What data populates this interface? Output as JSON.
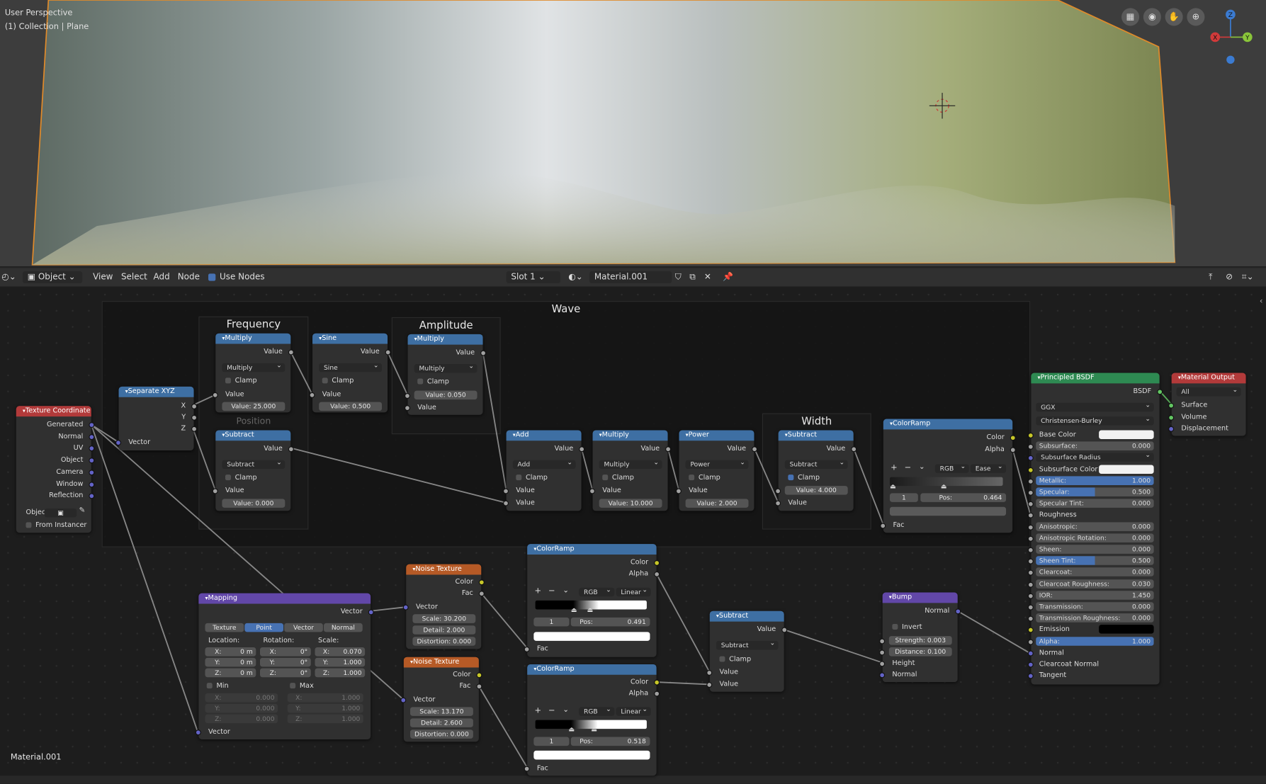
{
  "viewport": {
    "mode": "User Perspective",
    "collection": "(1) Collection | Plane",
    "gizmo": {
      "z": "Z",
      "y": "Y",
      "x": "X"
    }
  },
  "header": {
    "mode": "Object",
    "menu": [
      "View",
      "Select",
      "Add",
      "Node"
    ],
    "use_nodes": "Use Nodes",
    "slot": "Slot 1",
    "material": "Material.001"
  },
  "frames": {
    "wave": "Wave",
    "frequency": "Frequency",
    "amplitude": "Amplitude",
    "position": "Position",
    "width": "Width"
  },
  "nodes": {
    "texcoord": {
      "title": "Texture Coordinate",
      "outputs": [
        "Generated",
        "Normal",
        "UV",
        "Object",
        "Camera",
        "Window",
        "Reflection"
      ],
      "object": "Objec",
      "from_instancer": "From Instancer"
    },
    "sepxyz": {
      "title": "Separate XYZ",
      "outputs": [
        "X",
        "Y",
        "Z"
      ],
      "input": "Vector"
    },
    "mul1": {
      "title": "Multiply",
      "out": "Value",
      "op": "Multiply",
      "clamp": "Clamp",
      "in": "Value",
      "field": "Value:",
      "value": "25.000"
    },
    "sine": {
      "title": "Sine",
      "out": "Value",
      "op": "Sine",
      "clamp": "Clamp",
      "in": "Value",
      "field": "Value:",
      "value": "0.500"
    },
    "mul2": {
      "title": "Multiply",
      "out": "Value",
      "op": "Multiply",
      "clamp": "Clamp",
      "field": "Value:",
      "value": "0.050",
      "in": "Value"
    },
    "sub1": {
      "title": "Subtract",
      "out": "Value",
      "op": "Subtract",
      "clamp": "Clamp",
      "in": "Value",
      "field": "Value:",
      "value": "0.000"
    },
    "add": {
      "title": "Add",
      "out": "Value",
      "op": "Add",
      "clamp": "Clamp",
      "in1": "Value",
      "in2": "Value"
    },
    "mul3": {
      "title": "Multiply",
      "out": "Value",
      "op": "Multiply",
      "clamp": "Clamp",
      "in": "Value",
      "field": "Value:",
      "value": "10.000"
    },
    "power": {
      "title": "Power",
      "out": "Value",
      "op": "Power",
      "clamp": "Clamp",
      "in": "Value",
      "field": "Value:",
      "value": "2.000"
    },
    "sub2": {
      "title": "Subtract",
      "out": "Value",
      "op": "Subtract",
      "clamp": "Clamp",
      "field": "Value:",
      "value": "4.000",
      "in": "Value"
    },
    "ramp1": {
      "title": "ColorRamp",
      "outputs": [
        "Color",
        "Alpha"
      ],
      "plus": "+",
      "minus": "−",
      "mode": "RGB",
      "interp": "Ease",
      "index": "1",
      "pos_label": "Pos:",
      "pos": "0.464",
      "in": "Fac"
    },
    "noise1": {
      "title": "Noise Texture",
      "outputs": [
        "Color",
        "Fac"
      ],
      "in": "Vector",
      "scale_l": "Scale:",
      "scale": "30.200",
      "detail_l": "Detail:",
      "detail": "2.000",
      "dist_l": "Distortion:",
      "dist": "0.000"
    },
    "noise2": {
      "title": "Noise Texture",
      "outputs": [
        "Color",
        "Fac"
      ],
      "in": "Vector",
      "scale_l": "Scale:",
      "scale": "13.170",
      "detail_l": "Detail:",
      "detail": "2.600",
      "dist_l": "Distortion:",
      "dist": "0.000"
    },
    "ramp2": {
      "title": "ColorRamp",
      "outputs": [
        "Color",
        "Alpha"
      ],
      "plus": "+",
      "minus": "−",
      "mode": "RGB",
      "interp": "Linear",
      "index": "1",
      "pos_label": "Pos:",
      "pos": "0.491",
      "in": "Fac"
    },
    "ramp3": {
      "title": "ColorRamp",
      "outputs": [
        "Color",
        "Alpha"
      ],
      "plus": "+",
      "minus": "−",
      "mode": "RGB",
      "interp": "Linear",
      "index": "1",
      "pos_label": "Pos:",
      "pos": "0.518",
      "in": "Fac"
    },
    "mapping": {
      "title": "Mapping",
      "out": "Vector",
      "tabs": [
        "Texture",
        "Point",
        "Vector",
        "Normal"
      ],
      "loc_label": "Location:",
      "rot_label": "Rotation:",
      "scale_label": "Scale:",
      "axes": [
        "X:",
        "Y:",
        "Z:"
      ],
      "loc": [
        "0 m",
        "0 m",
        "0 m"
      ],
      "rot": [
        "0°",
        "0°",
        "0°"
      ],
      "scl": [
        "0.070",
        "1.000",
        "1.000"
      ],
      "min": "Min",
      "max": "Max",
      "minv": [
        "0.000",
        "0.000",
        "0.000"
      ],
      "maxv": [
        "1.000",
        "1.000",
        "1.000"
      ],
      "in": "Vector"
    },
    "sub3": {
      "title": "Subtract",
      "out": "Value",
      "op": "Subtract",
      "clamp": "Clamp",
      "in1": "Value",
      "in2": "Value"
    },
    "bump": {
      "title": "Bump",
      "out": "Normal",
      "invert": "Invert",
      "str_l": "Strength:",
      "str": "0.003",
      "dist_l": "Distance:",
      "dist": "0.100",
      "in1": "Height",
      "in2": "Normal"
    },
    "bsdf": {
      "title": "Principled BSDF",
      "out": "BSDF",
      "dist": "GGX",
      "sss": "Christensen-Burley",
      "rows": [
        {
          "label": "Base Color",
          "value": ""
        },
        {
          "label": "Subsurface:",
          "value": "0.000"
        },
        {
          "label": "Subsurface Radius",
          "value": ""
        },
        {
          "label": "Subsurface Color",
          "value": ""
        },
        {
          "label": "Metallic:",
          "value": "1.000"
        },
        {
          "label": "Specular:",
          "value": "0.500"
        },
        {
          "label": "Specular Tint:",
          "value": "0.000"
        },
        {
          "label": "Roughness",
          "value": ""
        },
        {
          "label": "Anisotropic:",
          "value": "0.000"
        },
        {
          "label": "Anisotropic Rotation:",
          "value": "0.000"
        },
        {
          "label": "Sheen:",
          "value": "0.000"
        },
        {
          "label": "Sheen Tint:",
          "value": "0.500"
        },
        {
          "label": "Clearcoat:",
          "value": "0.000"
        },
        {
          "label": "Clearcoat Roughness:",
          "value": "0.030"
        },
        {
          "label": "IOR:",
          "value": "1.450"
        },
        {
          "label": "Transmission:",
          "value": "0.000"
        },
        {
          "label": "Transmission Roughness:",
          "value": "0.000"
        },
        {
          "label": "Emission",
          "value": ""
        },
        {
          "label": "Alpha:",
          "value": "1.000"
        },
        {
          "label": "Normal",
          "value": ""
        },
        {
          "label": "Clearcoat Normal",
          "value": ""
        },
        {
          "label": "Tangent",
          "value": ""
        }
      ]
    },
    "output": {
      "title": "Material Output",
      "target": "All",
      "inputs": [
        "Surface",
        "Volume",
        "Displacement"
      ]
    }
  },
  "footer": {
    "material": "Material.001"
  },
  "colors": {
    "math": "#3e6fa3",
    "input": "#b23a3a",
    "texture": "#b65a26",
    "vector": "#6247a8",
    "shader": "#2e8a52",
    "output": "#b23a3a",
    "accent": "#4772b3"
  }
}
